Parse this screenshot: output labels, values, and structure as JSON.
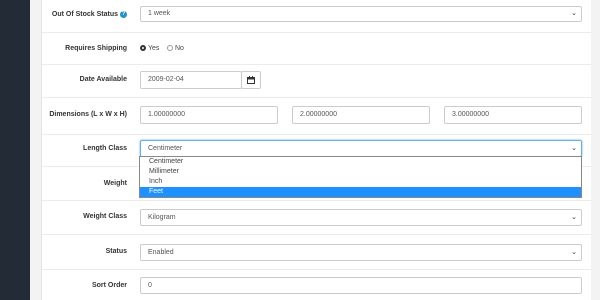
{
  "out_of_stock": {
    "label": "Out Of Stock Status",
    "value": "1 week"
  },
  "requires_shipping": {
    "label": "Requires Shipping",
    "yes_label": "Yes",
    "no_label": "No",
    "selected": "Yes"
  },
  "date_available": {
    "label": "Date Available",
    "value": "2009-02-04"
  },
  "dimensions": {
    "label": "Dimensions (L x W x H)",
    "length": "1.00000000",
    "width": "2.00000000",
    "height": "3.00000000"
  },
  "length_class": {
    "label": "Length Class",
    "value": "Centimeter",
    "options": [
      "Centimeter",
      "Millimeter",
      "Inch",
      "Feet"
    ],
    "highlighted": "Feet"
  },
  "weight": {
    "label": "Weight"
  },
  "weight_class": {
    "label": "Weight Class",
    "value": "Kilogram"
  },
  "status": {
    "label": "Status",
    "value": "Enabled"
  },
  "sort_order": {
    "label": "Sort Order",
    "value": "0"
  },
  "colors": {
    "sidebar": "#222b36",
    "highlight": "#1e90ff",
    "help": "#1e91cf"
  }
}
